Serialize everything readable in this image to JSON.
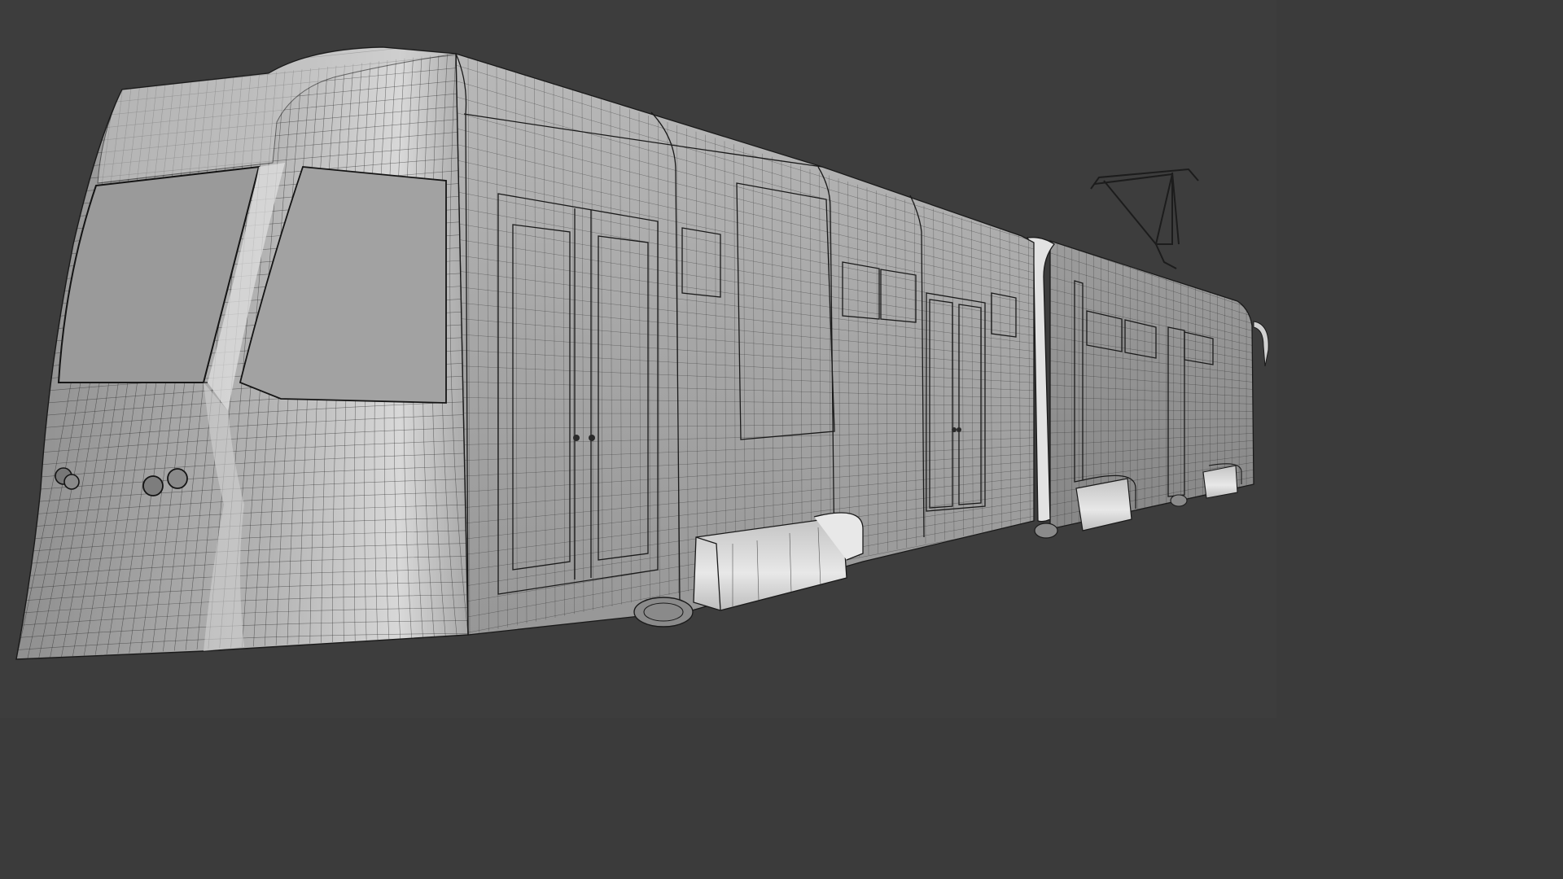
{
  "viewport": {
    "background": "#3d3d3d"
  },
  "model": {
    "object": "wireframe-tram",
    "shading": "solid-grey-with-wireframe",
    "body_color": "#a9a9a9",
    "highlight_color": "#e4e4e4",
    "wire_color": "#1f1f1f"
  }
}
